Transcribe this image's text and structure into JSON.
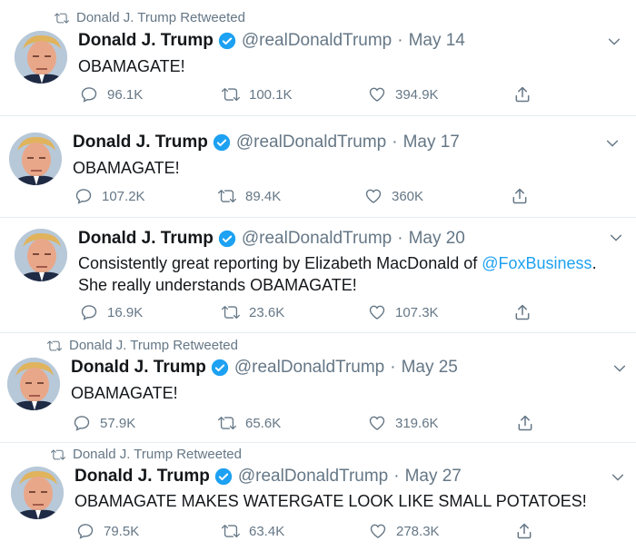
{
  "retweet_label": "Donald J. Trump Retweeted",
  "author": {
    "name": "Donald J. Trump",
    "handle": "@realDonaldTrump"
  },
  "separator": "·",
  "tweets": [
    {
      "retweeted": true,
      "date": "May 14",
      "text_line1": "OBAMAGATE!",
      "replies": "96.1K",
      "retweets": "100.1K",
      "likes": "394.9K"
    },
    {
      "retweeted": false,
      "date": "May 17",
      "text_line1": "OBAMAGATE!",
      "replies": "107.2K",
      "retweets": "89.4K",
      "likes": "360K"
    },
    {
      "retweeted": false,
      "date": "May 20",
      "text_line1_pre": "Consistently great reporting by Elizabeth MacDonald of ",
      "mention": "@FoxBusiness",
      "text_line1_post": ".",
      "text_line2": "She really understands OBAMAGATE!",
      "replies": "16.9K",
      "retweets": "23.6K",
      "likes": "107.3K"
    },
    {
      "retweeted": true,
      "date": "May 25",
      "text_line1": "OBAMAGATE!",
      "replies": "57.9K",
      "retweets": "65.6K",
      "likes": "319.6K"
    },
    {
      "retweeted": true,
      "date": "May 27",
      "text_line1": "OBAMAGATE MAKES WATERGATE LOOK LIKE SMALL POTATOES!",
      "replies": "79.5K",
      "retweets": "63.4K",
      "likes": "278.3K"
    }
  ],
  "colors": {
    "accent": "#1da1f2",
    "muted": "#657786",
    "text": "#14171a",
    "divider": "#e6ecf0"
  },
  "icons": [
    "retweet-icon",
    "verified-icon",
    "chevron-down-icon",
    "reply-icon",
    "like-icon",
    "share-icon"
  ]
}
